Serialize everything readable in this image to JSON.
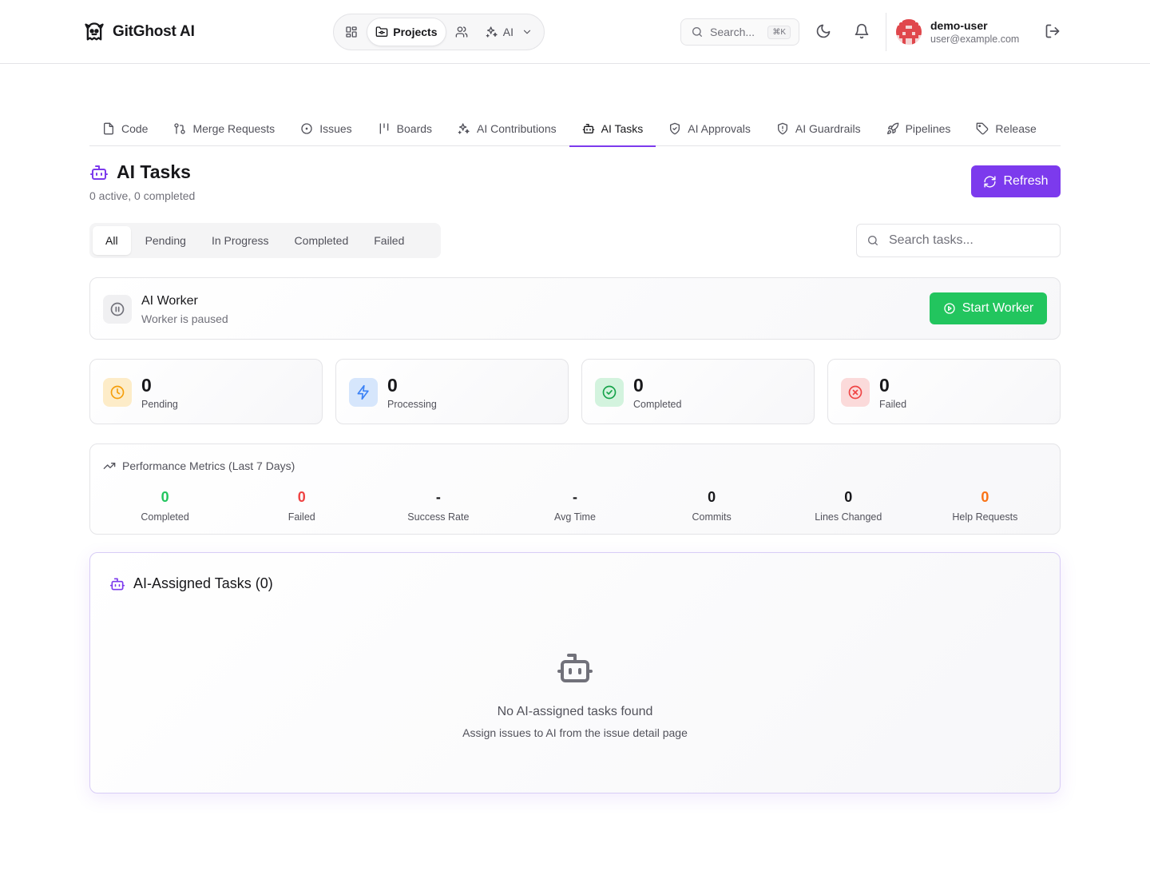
{
  "app": {
    "name": "GitGhost AI"
  },
  "topnav": {
    "projects_label": "Projects",
    "ai_label": "AI"
  },
  "search": {
    "placeholder": "Search...",
    "shortcut": "⌘K"
  },
  "user": {
    "name": "demo-user",
    "email": "user@example.com"
  },
  "project_tabs": [
    {
      "label": "Code",
      "icon": "file-icon"
    },
    {
      "label": "Merge Requests",
      "icon": "git-merge-icon"
    },
    {
      "label": "Issues",
      "icon": "circle-dot-icon"
    },
    {
      "label": "Boards",
      "icon": "kanban-icon"
    },
    {
      "label": "AI Contributions",
      "icon": "sparkles-icon"
    },
    {
      "label": "AI Tasks",
      "icon": "bot-icon",
      "active": true
    },
    {
      "label": "AI Approvals",
      "icon": "shield-check-icon"
    },
    {
      "label": "AI Guardrails",
      "icon": "shield-alert-icon"
    },
    {
      "label": "Pipelines",
      "icon": "rocket-icon"
    },
    {
      "label": "Release",
      "icon": "tag-icon"
    }
  ],
  "page": {
    "title": "AI Tasks",
    "subtitle": "0 active, 0 completed",
    "refresh_label": "Refresh"
  },
  "filters": {
    "tabs": [
      "All",
      "Pending",
      "In Progress",
      "Completed",
      "Failed"
    ],
    "active": "All",
    "search_placeholder": "Search tasks..."
  },
  "worker": {
    "title": "AI Worker",
    "status": "Worker is paused",
    "button_label": "Start Worker"
  },
  "stats": [
    {
      "value": "0",
      "label": "Pending",
      "color": "#f59e0b",
      "bg": "#fdecc8",
      "icon": "clock-icon"
    },
    {
      "value": "0",
      "label": "Processing",
      "color": "#3b82f6",
      "bg": "#d6e6fc",
      "icon": "zap-icon"
    },
    {
      "value": "0",
      "label": "Completed",
      "color": "#16a34a",
      "bg": "#d3f3de",
      "icon": "check-circle-icon"
    },
    {
      "value": "0",
      "label": "Failed",
      "color": "#ef4444",
      "bg": "#fbdada",
      "icon": "x-circle-icon"
    }
  ],
  "performance": {
    "title": "Performance Metrics (Last 7 Days)",
    "metrics": [
      {
        "value": "0",
        "label": "Completed",
        "color": "#22c55e"
      },
      {
        "value": "0",
        "label": "Failed",
        "color": "#ef4444"
      },
      {
        "value": "-",
        "label": "Success Rate",
        "color": "#18181b"
      },
      {
        "value": "-",
        "label": "Avg Time",
        "color": "#18181b"
      },
      {
        "value": "0",
        "label": "Commits",
        "color": "#18181b"
      },
      {
        "value": "0",
        "label": "Lines Changed",
        "color": "#18181b"
      },
      {
        "value": "0",
        "label": "Help Requests",
        "color": "#f97316"
      }
    ]
  },
  "assigned": {
    "title": "AI-Assigned Tasks (0)",
    "empty_title": "No AI-assigned tasks found",
    "empty_subtitle": "Assign issues to AI from the issue detail page"
  },
  "colors": {
    "accent": "#7c3aed",
    "success": "#22c55e"
  }
}
